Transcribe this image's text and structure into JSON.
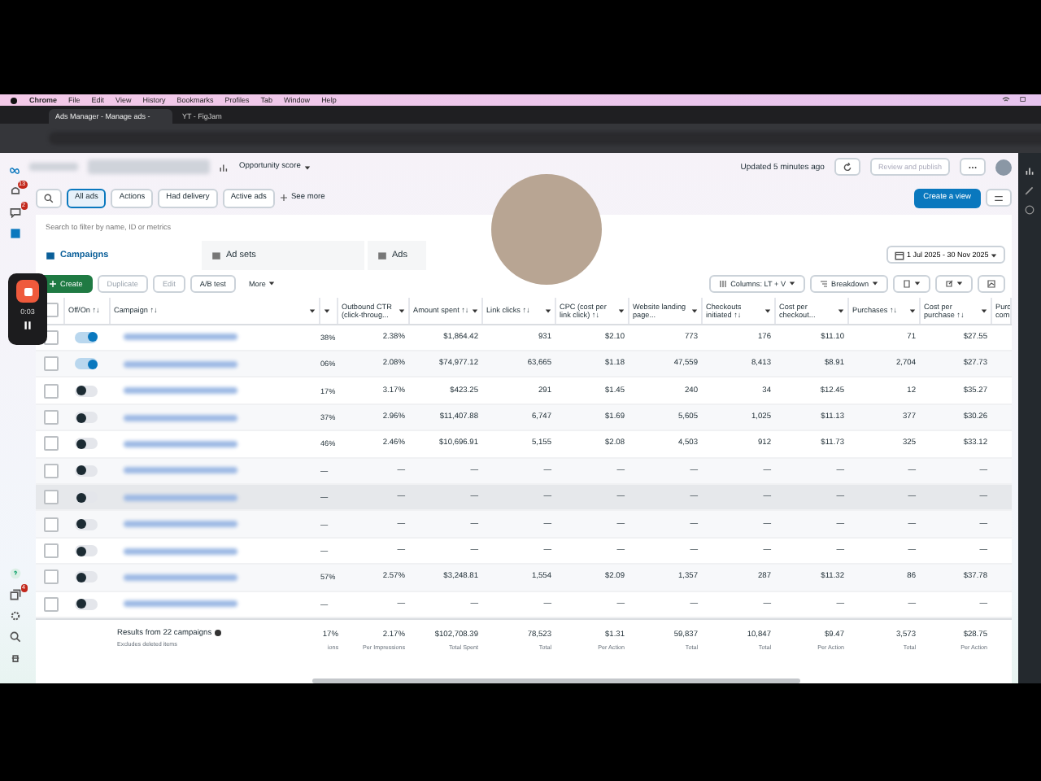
{
  "menubar": {
    "items": [
      "Chrome",
      "File",
      "Edit",
      "View",
      "History",
      "Bookmarks",
      "Profiles",
      "Tab",
      "Window",
      "Help"
    ]
  },
  "browser_tabs": [
    {
      "title": "Ads Manager - Manage ads -",
      "selected": true
    },
    {
      "title": "YT - FigJam",
      "selected": false
    }
  ],
  "sidebar": {
    "badges": [
      "13",
      "2",
      "4"
    ]
  },
  "recording": {
    "timer": "0:03"
  },
  "header": {
    "opportunity": "Opportunity score",
    "updated": "Updated 5 minutes ago",
    "review_button": {
      "label": "Review and publish",
      "disabled": true
    }
  },
  "filters": [
    {
      "label": "All ads",
      "selected": true
    },
    {
      "label": "Actions",
      "selected": false
    },
    {
      "label": "Had delivery",
      "selected": false
    },
    {
      "label": "Active ads",
      "selected": false
    }
  ],
  "see_more": "See more",
  "create_view": "Create a view",
  "search": {
    "placeholder": "Search to filter by name, ID or metrics"
  },
  "level_tabs": [
    {
      "label": "Campaigns",
      "selected": true
    },
    {
      "label": "Ad sets",
      "selected": false
    },
    {
      "label": "Ads",
      "selected": false
    }
  ],
  "date_range": "1 Jul 2025 - 30 Nov 2025",
  "toolbar": [
    {
      "label": "Create",
      "kind": "primary",
      "disabled": false
    },
    {
      "label": "Duplicate",
      "kind": "plain",
      "disabled": true
    },
    {
      "label": "Edit",
      "kind": "plain",
      "disabled": true
    },
    {
      "label": "A/B test",
      "kind": "plain",
      "disabled": false
    },
    {
      "label": "More",
      "kind": "menu",
      "disabled": false
    }
  ],
  "columns_button": "Columns: LT + V",
  "breakdown_button": "Breakdown",
  "table": {
    "all_selected": false,
    "columns": [
      "Off/On ↑↓",
      "Campaign ↑↓",
      "",
      "Outbound CTR (click-throug...",
      "Amount spent ↑↓",
      "Link clicks ↑↓",
      "CPC (cost per link click) ↑↓",
      "Website landing page...",
      "Checkouts initiated ↑↓",
      "Cost per checkout...",
      "Purchases ↑↓",
      "Cost per purchase ↑↓",
      "Purc com"
    ],
    "rows": [
      {
        "on": true,
        "hovered": false,
        "cells": [
          "38%",
          "2.38%",
          "$1,864.42",
          "931",
          "$2.10",
          "773",
          "176",
          "$11.10",
          "71",
          "$27.55"
        ]
      },
      {
        "on": true,
        "hovered": false,
        "cells": [
          "06%",
          "2.08%",
          "$74,977.12",
          "63,665",
          "$1.18",
          "47,559",
          "8,413",
          "$8.91",
          "2,704",
          "$27.73"
        ]
      },
      {
        "on": false,
        "hovered": false,
        "cells": [
          "17%",
          "3.17%",
          "$423.25",
          "291",
          "$1.45",
          "240",
          "34",
          "$12.45",
          "12",
          "$35.27"
        ]
      },
      {
        "on": false,
        "hovered": false,
        "cells": [
          "37%",
          "2.96%",
          "$11,407.88",
          "6,747",
          "$1.69",
          "5,605",
          "1,025",
          "$11.13",
          "377",
          "$30.26"
        ]
      },
      {
        "on": false,
        "hovered": false,
        "cells": [
          "46%",
          "2.46%",
          "$10,696.91",
          "5,155",
          "$2.08",
          "4,503",
          "912",
          "$11.73",
          "325",
          "$33.12"
        ]
      },
      {
        "on": false,
        "hovered": false,
        "cells": [
          "—",
          "—",
          "—",
          "—",
          "—",
          "—",
          "—",
          "—",
          "—",
          "—"
        ]
      },
      {
        "on": false,
        "hovered": true,
        "cells": [
          "—",
          "—",
          "—",
          "—",
          "—",
          "—",
          "—",
          "—",
          "—",
          "—"
        ]
      },
      {
        "on": false,
        "hovered": false,
        "cells": [
          "—",
          "—",
          "—",
          "—",
          "—",
          "—",
          "—",
          "—",
          "—",
          "—"
        ]
      },
      {
        "on": false,
        "hovered": false,
        "cells": [
          "—",
          "—",
          "—",
          "—",
          "—",
          "—",
          "—",
          "—",
          "—",
          "—"
        ]
      },
      {
        "on": false,
        "hovered": false,
        "cells": [
          "57%",
          "2.57%",
          "$3,248.81",
          "1,554",
          "$2.09",
          "1,357",
          "287",
          "$11.32",
          "86",
          "$37.78"
        ]
      },
      {
        "on": false,
        "hovered": false,
        "cells": [
          "—",
          "—",
          "—",
          "—",
          "—",
          "—",
          "—",
          "—",
          "—",
          "—"
        ]
      }
    ],
    "totals": {
      "label": "Results from 22 campaigns",
      "note": "Excludes deleted items",
      "cells": [
        {
          "value": "17%",
          "caption": "ions"
        },
        {
          "value": "2.17%",
          "caption": "Per Impressions"
        },
        {
          "value": "$102,708.39",
          "caption": "Total Spent"
        },
        {
          "value": "78,523",
          "caption": "Total"
        },
        {
          "value": "$1.31",
          "caption": "Per Action"
        },
        {
          "value": "59,837",
          "caption": "Total"
        },
        {
          "value": "10,847",
          "caption": "Total"
        },
        {
          "value": "$9.47",
          "caption": "Per Action"
        },
        {
          "value": "3,573",
          "caption": "Total"
        },
        {
          "value": "$28.75",
          "caption": "Per Action"
        }
      ]
    }
  }
}
